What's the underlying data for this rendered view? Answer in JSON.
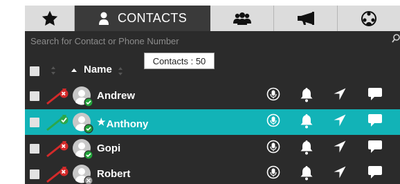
{
  "tabs": [
    {
      "id": "favorites",
      "icon": "star-icon",
      "label": ""
    },
    {
      "id": "contacts",
      "icon": "person-icon",
      "label": "CONTACTS"
    },
    {
      "id": "groups",
      "icon": "group-icon",
      "label": ""
    },
    {
      "id": "broadcast",
      "icon": "megaphone-icon",
      "label": ""
    },
    {
      "id": "conference",
      "icon": "conference-icon",
      "label": ""
    }
  ],
  "search": {
    "placeholder": "Search for Contact or Phone Number"
  },
  "tooltip": {
    "text": "Contacts : 50"
  },
  "header": {
    "name_label": "Name"
  },
  "contacts": [
    {
      "name": "Andrew",
      "status": "missed",
      "presence": "online",
      "starred": false,
      "selected": false
    },
    {
      "name": "Anthony",
      "status": "ok",
      "presence": "online",
      "starred": true,
      "selected": true
    },
    {
      "name": "Gopi",
      "status": "missed",
      "presence": "online",
      "starred": false,
      "selected": false
    },
    {
      "name": "Robert",
      "status": "missed",
      "presence": "offline",
      "starred": false,
      "selected": false
    }
  ],
  "row_actions": [
    "microphone-icon",
    "bell-icon",
    "location-arrow-icon",
    "chat-bubble-icon"
  ],
  "colors": {
    "panel": "#2b2b2b",
    "active_tab": "#3a3a3a",
    "tab": "#dcdcdc",
    "selected_row": "#12b3b7",
    "presence_online": "#22a33a",
    "arrow_missed": "#d42a2a",
    "arrow_ok": "#2ba84a"
  }
}
